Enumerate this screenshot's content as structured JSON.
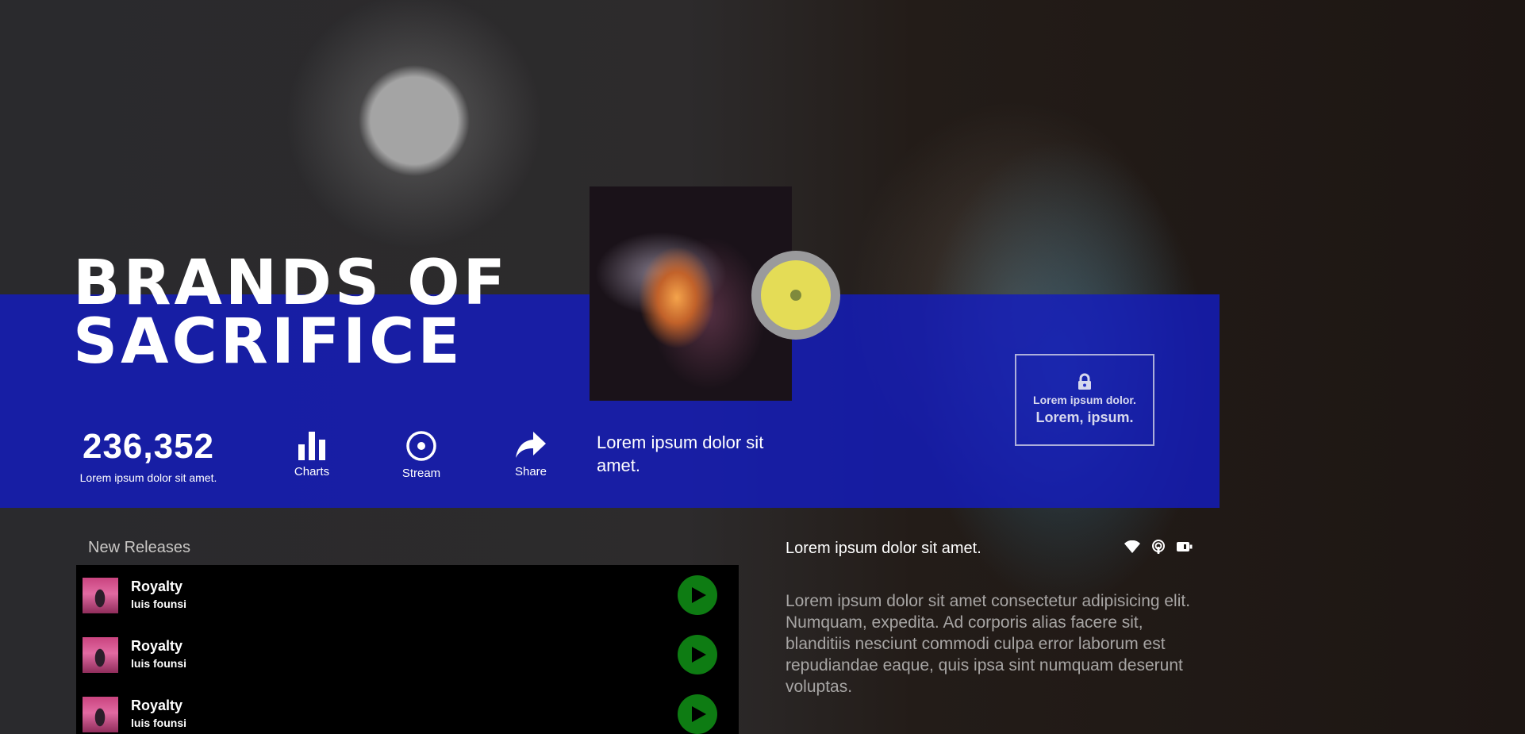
{
  "hero": {
    "title": "BRANDS OF\nSACRIFICE",
    "stat_value": "236,352",
    "stat_label": "Lorem ipsum dolor sit amet.",
    "tagline": "Lorem ipsum dolor sit amet."
  },
  "actions": [
    {
      "label": "Charts",
      "icon": "bar-chart-icon"
    },
    {
      "label": "Stream",
      "icon": "stream-icon"
    },
    {
      "label": "Share",
      "icon": "share-icon"
    }
  ],
  "lock_panel": {
    "icon": "lock-icon",
    "line1": "Lorem ipsum dolor.",
    "line2": "Lorem, ipsum."
  },
  "releases": {
    "title": "New Releases",
    "tracks": [
      {
        "title": "Royalty",
        "artist": "luis founsi"
      },
      {
        "title": "Royalty",
        "artist": "luis founsi"
      },
      {
        "title": "Royalty",
        "artist": "luis founsi"
      }
    ]
  },
  "info": {
    "heading": "Lorem ipsum dolor sit amet.",
    "icons": [
      "wifi-icon",
      "podcast-icon",
      "battery-icon"
    ],
    "body": "Lorem ipsum dolor sit amet consectetur adipisicing elit. Numquam, expedita. Ad corporis alias facere sit, blanditiis nesciunt commodi culpa error laborum est repudiandae eaque, quis ipsa sint numquam deserunt voluptas."
  },
  "colors": {
    "band": "#141cbe",
    "disc": "#e4dc56",
    "play_button": "#0e7c13"
  }
}
